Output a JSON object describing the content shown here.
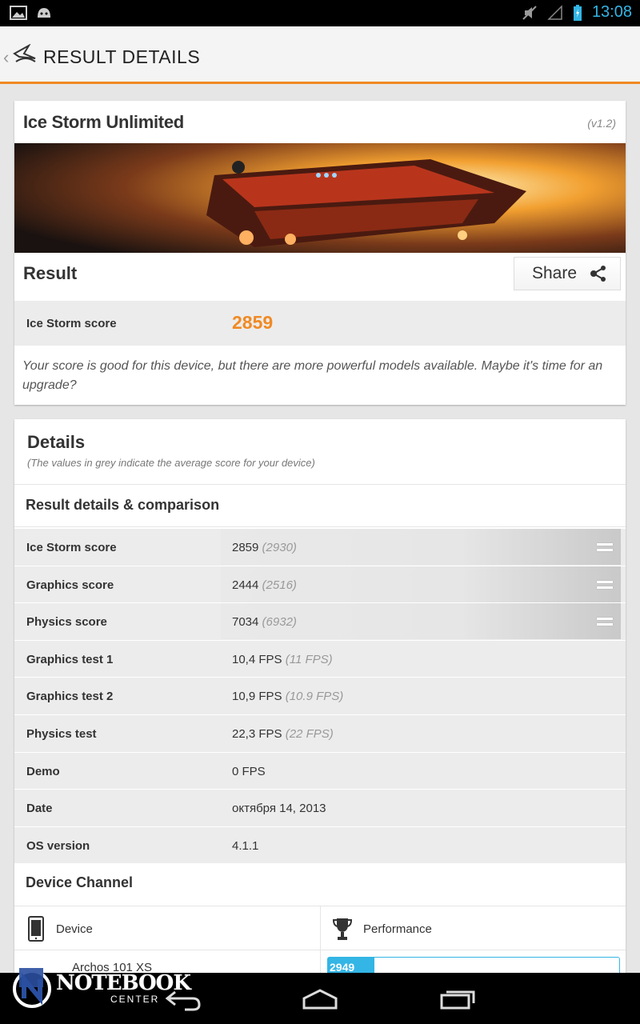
{
  "status_bar": {
    "time": "13:08"
  },
  "action_bar": {
    "title": "RESULT DETAILS"
  },
  "result_card": {
    "title": "Ice Storm Unlimited",
    "version": "(v1.2)",
    "result_label": "Result",
    "share_label": "Share",
    "score_label": "Ice Storm score",
    "score_value": "2859",
    "message": "Your score is good for this device, but there are more powerful models available. Maybe it's time for an upgrade?"
  },
  "details": {
    "title": "Details",
    "subtitle": "(The values in grey indicate the average score for your device)",
    "comparison_title": "Result details & comparison",
    "rows": [
      {
        "label": "Ice Storm score",
        "value": "2859",
        "avg": "(2930)"
      },
      {
        "label": "Graphics score",
        "value": "2444",
        "avg": "(2516)"
      },
      {
        "label": "Physics score",
        "value": "7034",
        "avg": "(6932)"
      },
      {
        "label": "Graphics test 1",
        "value": "10,4 FPS",
        "avg": "(11 FPS)"
      },
      {
        "label": "Graphics test 2",
        "value": "10,9 FPS",
        "avg": "(10.9 FPS)"
      },
      {
        "label": "Physics test",
        "value": "22,3 FPS",
        "avg": "(22 FPS)"
      },
      {
        "label": "Demo",
        "value": "0 FPS",
        "avg": ""
      },
      {
        "label": "Date",
        "value": "октября 14, 2013",
        "avg": ""
      },
      {
        "label": "OS version",
        "value": "4.1.1",
        "avg": ""
      }
    ],
    "device_channel_title": "Device Channel",
    "device_header": "Device",
    "performance_header": "Performance",
    "device_name": "Archos 101 XS",
    "device_score": "2949",
    "device_score_fraction": 0.16
  },
  "watermark": {
    "line1": "NOTEBOOK",
    "line2": "CENTER"
  },
  "colors": {
    "accent": "#f08a24",
    "holo_blue": "#33b5e5"
  }
}
